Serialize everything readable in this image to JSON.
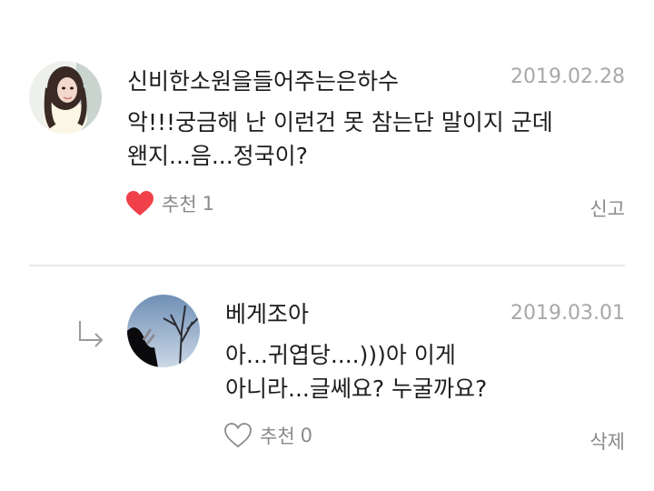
{
  "comments": [
    {
      "author": "신비한소원을들어주는은하수",
      "date": "2019.02.28",
      "text_lines": [
        "악!!!궁금해 난 이런건 못 참는단 말이지 군데",
        "왠지...음...정국이?"
      ],
      "like_label": "추천",
      "like_count": "1",
      "liked": true,
      "action_label": "신고",
      "avatar_icon": "profile-photo"
    }
  ],
  "reply": {
    "author": "베게조아",
    "date": "2019.03.01",
    "text_lines": [
      "아...귀엽당....)))아 이게",
      "아니라...글쎄요? 누굴까요?"
    ],
    "like_label": "추천",
    "like_count": "0",
    "liked": false,
    "action_label": "삭제",
    "avatar_icon": "profile-photo",
    "reply_icon": "reply-arrow-icon"
  },
  "colors": {
    "heart_filled": "#f0404a",
    "muted_text": "#8a8a8a",
    "date_text": "#a8a8a8",
    "divider": "#e6ebee"
  }
}
